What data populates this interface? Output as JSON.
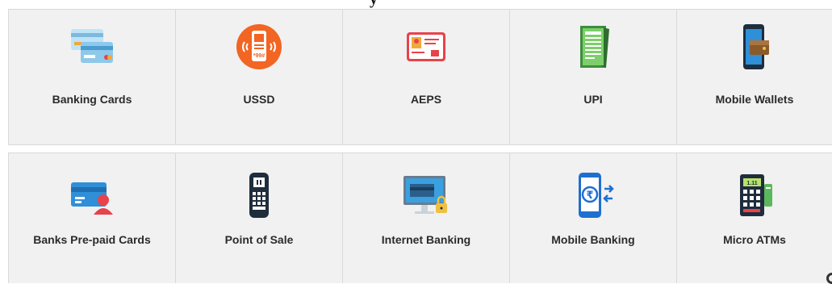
{
  "heading_fragment": "y",
  "rows": [
    {
      "tiles": [
        {
          "label": "Banking Cards",
          "icon": "banking-cards-icon"
        },
        {
          "label": "USSD",
          "icon": "ussd-phone-icon"
        },
        {
          "label": "AEPS",
          "icon": "aadhaar-card-icon"
        },
        {
          "label": "UPI",
          "icon": "upi-document-icon"
        },
        {
          "label": "Mobile Wallets",
          "icon": "mobile-wallet-icon"
        }
      ]
    },
    {
      "tiles": [
        {
          "label": "Banks Pre-paid Cards",
          "icon": "prepaid-card-user-icon"
        },
        {
          "label": "Point of Sale",
          "icon": "pos-terminal-icon"
        },
        {
          "label": "Internet Banking",
          "icon": "monitor-lock-icon"
        },
        {
          "label": "Mobile Banking",
          "icon": "mobile-rupee-icon"
        },
        {
          "label": "Micro ATMs",
          "icon": "micro-atm-icon"
        }
      ]
    }
  ],
  "colors": {
    "tile_bg": "#f1f1f1",
    "border": "#d9d9d9",
    "label": "#2b2b2b",
    "orange": "#f26522",
    "red": "#e8434a",
    "blue": "#2f8fd8",
    "green": "#5cb85c",
    "dark_navy": "#1f2d3d"
  }
}
